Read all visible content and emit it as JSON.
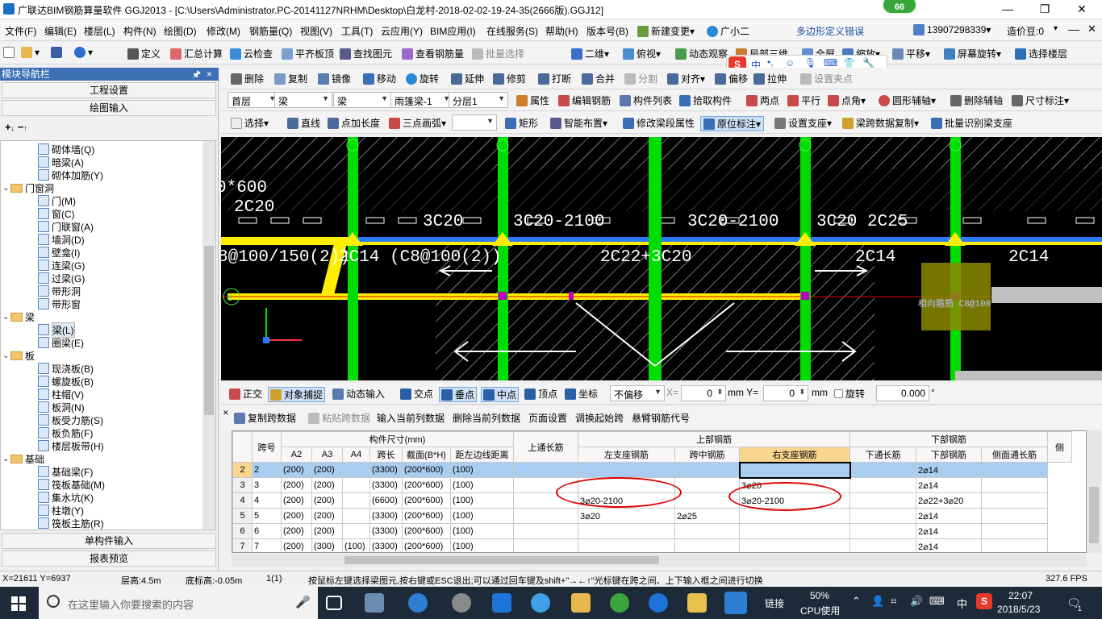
{
  "titlebar": {
    "title": "广联达BIM钢筋算量软件 GGJ2013 - [C:\\Users\\Administrator.PC-20141127NRHM\\Desktop\\白龙村-2018-02-02-19-24-35(2666版).GGJ12]",
    "badge": "66",
    "minimize": "—",
    "restore": "❐",
    "close": "✕"
  },
  "menubar": {
    "items": [
      "文件(F)",
      "编辑(E)",
      "楼层(L)",
      "构件(N)",
      "绘图(D)",
      "修改(M)",
      "钢筋量(Q)",
      "视图(V)",
      "工具(T)",
      "云应用(Y)",
      "BIM应用(I)",
      "在线服务(S)",
      "帮助(H)",
      "版本号(B)",
      "新建变更",
      "广小二"
    ],
    "error_text": "多边形定义错误",
    "phone": "13907298339",
    "price": "造价豆:0"
  },
  "toolbar1": {
    "items": [
      "定义",
      "汇总计算",
      "云检查",
      "平齐板顶",
      "查找图元",
      "查看钢筋量",
      "批量选择",
      "二维",
      "俯视",
      "动态观察",
      "局部三维",
      "全屏",
      "缩放",
      "平移",
      "屏幕旋转",
      "选择楼层"
    ]
  },
  "toolbar2": {
    "items": [
      "删除",
      "复制",
      "镜像",
      "移动",
      "旋转",
      "延伸",
      "修剪",
      "打断",
      "合并",
      "分割",
      "对齐",
      "偏移",
      "拉伸",
      "设置夹点"
    ]
  },
  "toolbar3": {
    "floor": "首层",
    "category": "梁",
    "type": "梁",
    "element": "雨篷梁-1",
    "layer": "分层1",
    "items": [
      "属性",
      "编辑钢筋",
      "构件列表",
      "拾取构件",
      "两点",
      "平行",
      "点角",
      "圆形辅轴",
      "删除辅轴",
      "尺寸标注"
    ]
  },
  "toolbar4": {
    "items": [
      "选择",
      "直线",
      "点加长度",
      "三点画弧",
      "矩形",
      "智能布置",
      "修改梁段属性",
      "原位标注",
      "设置支座",
      "梁跨数据复制",
      "批量识别梁支座"
    ]
  },
  "leftpanel": {
    "header": "模块导航栏",
    "pin": "🖈",
    "close": "×",
    "btn_project": "工程设置",
    "btn_draw": "绘图输入",
    "btn_single": "单构件输入",
    "btn_report": "报表预览",
    "tree": [
      {
        "label": "砌体墙(Q)",
        "level": 2
      },
      {
        "label": "暗梁(A)",
        "level": 2
      },
      {
        "label": "砌体加筋(Y)",
        "level": 2
      },
      {
        "label": "门窗洞",
        "level": 1,
        "folder": true
      },
      {
        "label": "门(M)",
        "level": 2
      },
      {
        "label": "窗(C)",
        "level": 2
      },
      {
        "label": "门联窗(A)",
        "level": 2
      },
      {
        "label": "墙洞(D)",
        "level": 2
      },
      {
        "label": "壁龛(I)",
        "level": 2
      },
      {
        "label": "连梁(G)",
        "level": 2
      },
      {
        "label": "过梁(G)",
        "level": 2
      },
      {
        "label": "带形洞",
        "level": 2
      },
      {
        "label": "带形窗",
        "level": 2
      },
      {
        "label": "梁",
        "level": 1,
        "folder": true
      },
      {
        "label": "梁(L)",
        "level": 2,
        "selected": true
      },
      {
        "label": "圈梁(E)",
        "level": 2
      },
      {
        "label": "板",
        "level": 1,
        "folder": true
      },
      {
        "label": "现浇板(B)",
        "level": 2
      },
      {
        "label": "螺旋板(B)",
        "level": 2
      },
      {
        "label": "柱帽(V)",
        "level": 2
      },
      {
        "label": "板洞(N)",
        "level": 2
      },
      {
        "label": "板受力筋(S)",
        "level": 2
      },
      {
        "label": "板负筋(F)",
        "level": 2
      },
      {
        "label": "楼层板带(H)",
        "level": 2
      },
      {
        "label": "基础",
        "level": 1,
        "folder": true
      },
      {
        "label": "基础梁(F)",
        "level": 2
      },
      {
        "label": "筏板基础(M)",
        "level": 2
      },
      {
        "label": "集水坑(K)",
        "level": 2
      },
      {
        "label": "柱墩(Y)",
        "level": 2
      },
      {
        "label": "筏板主筋(R)",
        "level": 2
      }
    ]
  },
  "canvas": {
    "labels": [
      "0*600",
      "2C20",
      "3C20",
      "3C20-2100",
      "3C20-2100",
      "3C20 2C25",
      "8@100/150(2))",
      "2C14 (C8@100(2))",
      "2C22+3C20",
      "2C14",
      "2C14",
      "相向箍筋 C8@100",
      "0"
    ]
  },
  "snapbar": {
    "items": [
      "正交",
      "对象捕捉",
      "动态输入",
      "交点",
      "垂点",
      "中点",
      "顶点",
      "坐标",
      "不偏移",
      "X=",
      "mm Y=",
      "mm",
      "旋转",
      "°"
    ],
    "x": "0",
    "y": "0",
    "rotate": "0.000"
  },
  "tabletools": {
    "items": [
      "复制跨数据",
      "粘贴跨数据",
      "输入当前列数据",
      "删除当前列数据",
      "页面设置",
      "调换起始跨",
      "悬臂钢筋代号"
    ]
  },
  "grid": {
    "group_headers": {
      "span": "跨号",
      "size": "构件尺寸(mm)",
      "top_long": "上通长筋",
      "top_rebar": "上部钢筋",
      "bottom_rebar": "下部钢筋"
    },
    "columns": [
      "A2",
      "A3",
      "A4",
      "跨长",
      "截面(B*H)",
      "距左边线距离",
      "左支座钢筋",
      "跨中钢筋",
      "右支座钢筋",
      "下通长筋",
      "下部钢筋",
      "侧面通长筋",
      "侧"
    ],
    "rows": [
      {
        "row": "2",
        "span": "2",
        "a2": "(200)",
        "a3": "(200)",
        "a4": "",
        "len": "(3300)",
        "sec": "(200*600)",
        "dist": "(100)",
        "top_long": "",
        "left": "",
        "mid": "",
        "right": "",
        "bot_long": "",
        "bot": "2⌀14",
        "side": ""
      },
      {
        "row": "3",
        "span": "3",
        "a2": "(200)",
        "a3": "(200)",
        "a4": "",
        "len": "(3300)",
        "sec": "(200*600)",
        "dist": "(100)",
        "top_long": "",
        "left": "",
        "mid": "",
        "right": "3⌀20",
        "bot_long": "",
        "bot": "2⌀14",
        "side": ""
      },
      {
        "row": "4",
        "span": "4",
        "a2": "(200)",
        "a3": "(200)",
        "a4": "",
        "len": "(6600)",
        "sec": "(200*600)",
        "dist": "(100)",
        "top_long": "",
        "left": "3⌀20-2100",
        "mid": "",
        "right": "3⌀20-2100",
        "bot_long": "",
        "bot": "2⌀22+3⌀20",
        "side": ""
      },
      {
        "row": "5",
        "span": "5",
        "a2": "(200)",
        "a3": "(200)",
        "a4": "",
        "len": "(3300)",
        "sec": "(200*600)",
        "dist": "(100)",
        "top_long": "",
        "left": "3⌀20",
        "mid": "2⌀25",
        "right": "",
        "bot_long": "",
        "bot": "2⌀14",
        "side": ""
      },
      {
        "row": "6",
        "span": "6",
        "a2": "(200)",
        "a3": "(200)",
        "a4": "",
        "len": "(3300)",
        "sec": "(200*600)",
        "dist": "(100)",
        "top_long": "",
        "left": "",
        "mid": "",
        "right": "",
        "bot_long": "",
        "bot": "2⌀14",
        "side": ""
      },
      {
        "row": "7",
        "span": "7",
        "a2": "(200)",
        "a3": "(300)",
        "a4": "(100)",
        "len": "(3300)",
        "sec": "(200*600)",
        "dist": "(100)",
        "top_long": "",
        "left": "",
        "mid": "",
        "right": "",
        "bot_long": "",
        "bot": "2⌀14",
        "side": ""
      }
    ]
  },
  "statusbar": {
    "coords": "X=21611 Y=6937",
    "floor_height": "层高:4.5m",
    "bottom_height": "底标高:-0.05m",
    "count": "1(1)",
    "hint": "按鼠标左键选择梁图元,按右键或ESC退出;可以通过回车键及shift+\"→←↑\"光标键在跨之间、上下输入框之间进行切换",
    "fps": "327.6 FPS"
  },
  "taskbar": {
    "search_placeholder": "在这里输入你要搜索的内容",
    "link": "链接",
    "cpu": "50%",
    "cpu_label": "CPU使用",
    "ime": "中",
    "time": "22:07",
    "date": "2018/5/23",
    "notify": "1"
  },
  "colors": {
    "canvas_bg": "#000000",
    "beam_yellow": "#ffee00",
    "column_green": "#00dd00",
    "axis_blue": "#2b7bff",
    "selection_row": "#a9cdf0",
    "annotation_red": "#e00000"
  }
}
